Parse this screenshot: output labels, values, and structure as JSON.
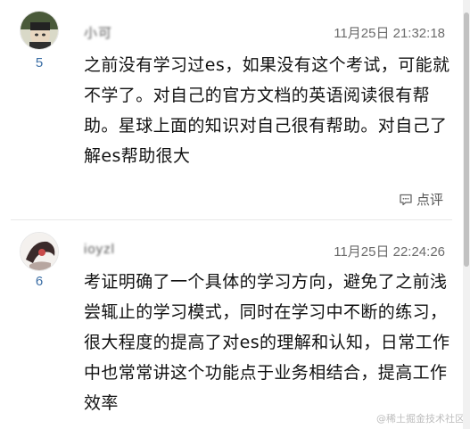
{
  "comments": [
    {
      "username": "小可",
      "rank": "5",
      "time": "11月25日 21:32:18",
      "content": "之前没有学习过es，如果没有这个考试，可能就不学了。对自己的官方文档的英语阅读很有帮助。星球上面的知识对自己很有帮助。对自己了解es帮助很大",
      "reply_label": "点评"
    },
    {
      "username": "ioyzl",
      "rank": "6",
      "time": "11月25日 22:24:26",
      "content": "考证明确了一个具体的学习方向，避免了之前浅尝辄止的学习模式，同时在学习中不断的练习，很大程度的提高了对es的理解和认知，日常工作中也常常讲这个功能点于业务相结合，提高工作效率"
    }
  ],
  "watermark": "@稀土掘金技术社区",
  "icons": {
    "reply": "comment-bubble-icon"
  },
  "colors": {
    "rank": "#3b6ea5",
    "time": "#6b6b6b"
  }
}
